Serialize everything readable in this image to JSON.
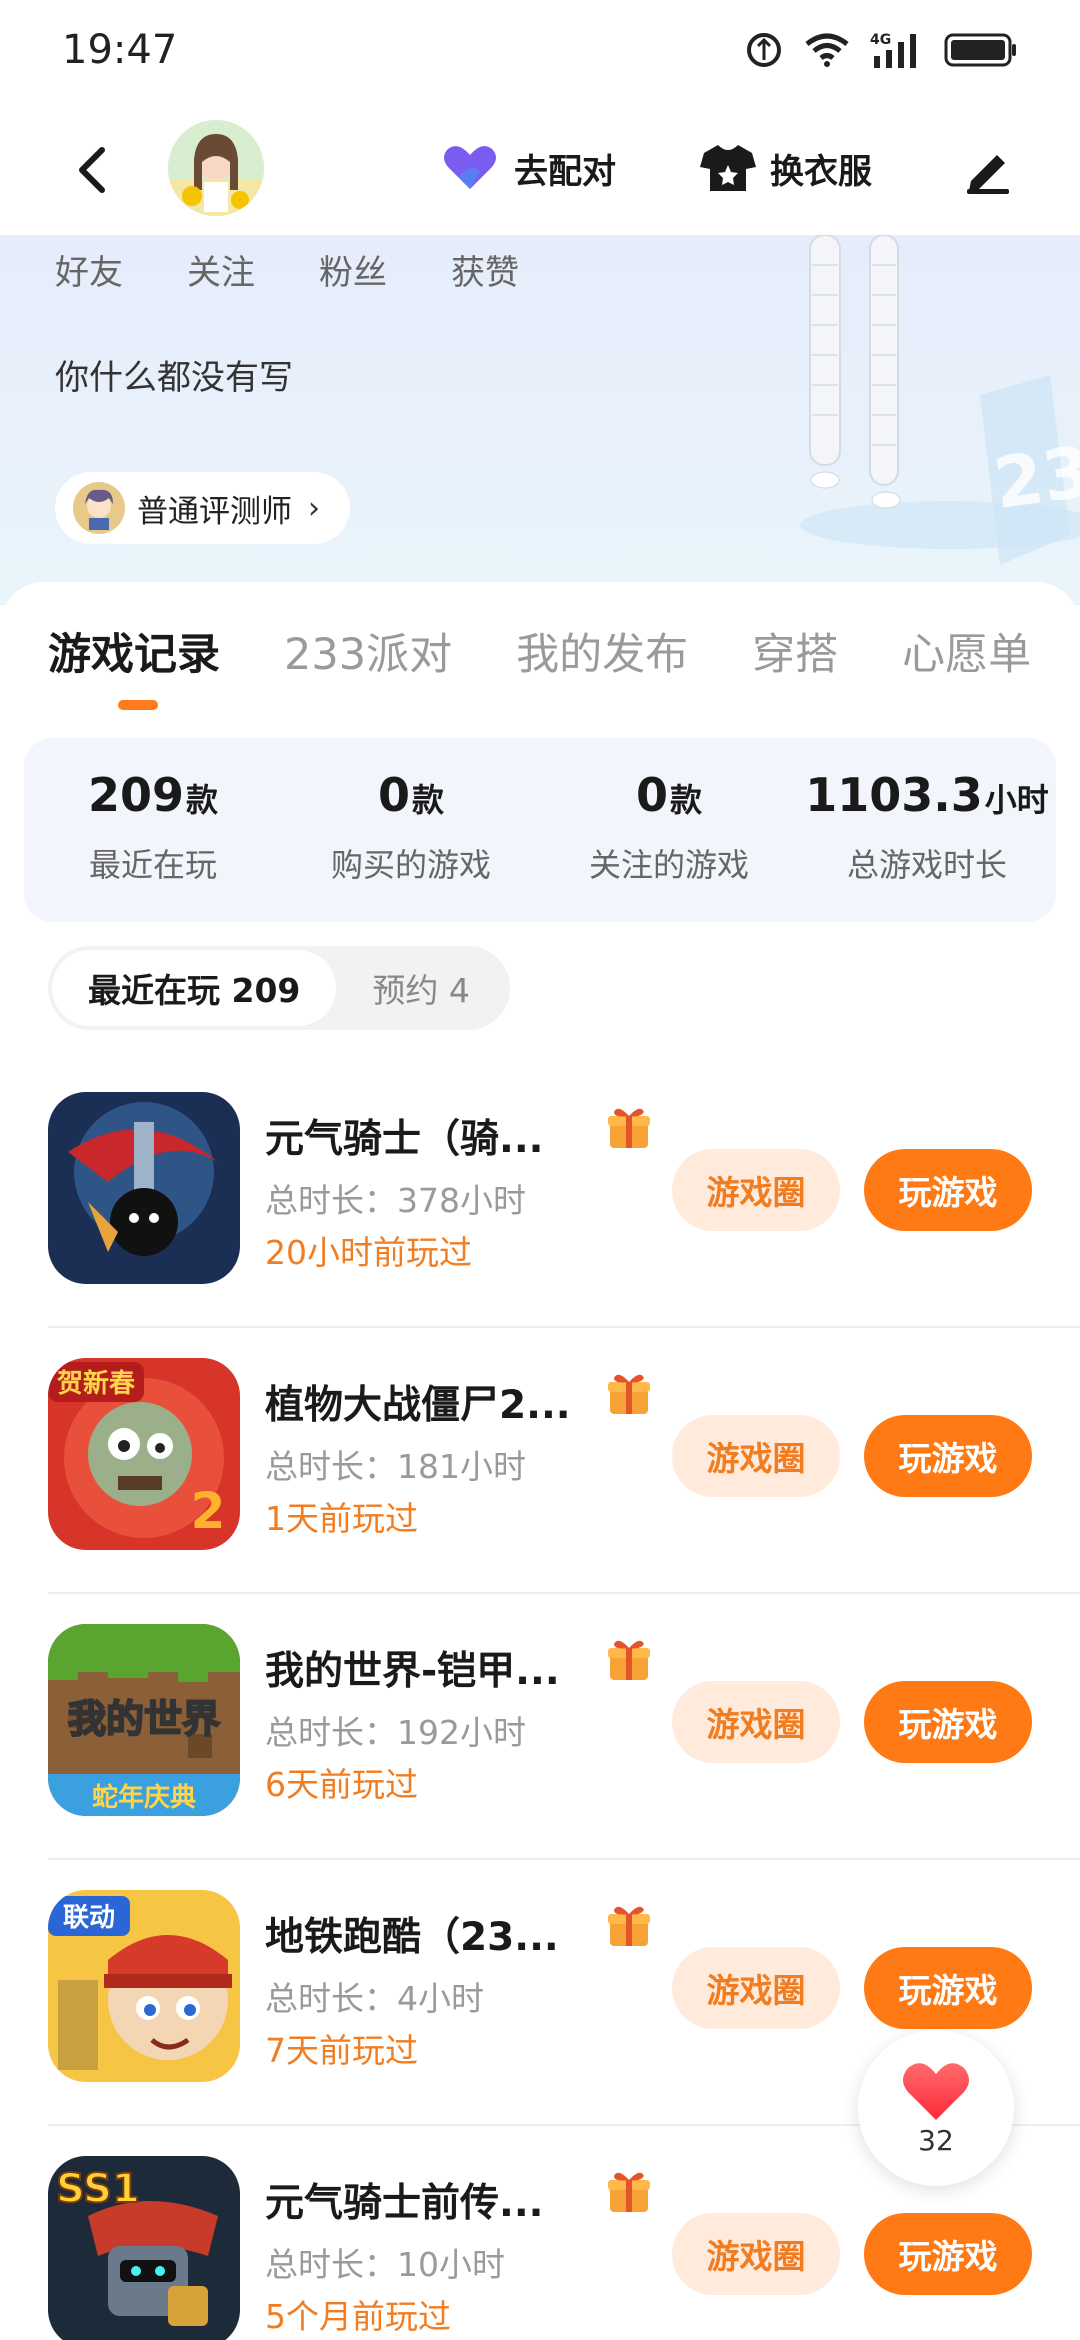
{
  "status_bar": {
    "time": "19:47",
    "network": "4G"
  },
  "nav": {
    "pair_label": "去配对",
    "dress_label": "换衣服"
  },
  "profile": {
    "stats": [
      "好友",
      "关注",
      "粉丝",
      "获赞"
    ],
    "bio": "你什么都没有写",
    "badge_label": "普通评测师",
    "badge_chevron": "›"
  },
  "tabs": [
    {
      "label": "游戏记录",
      "active": true
    },
    {
      "label": "233派对",
      "active": false
    },
    {
      "label": "我的发布",
      "active": false
    },
    {
      "label": "穿搭",
      "active": false
    },
    {
      "label": "心愿单",
      "active": false
    }
  ],
  "summary": [
    {
      "num": "209",
      "unit": "款",
      "label": "最近在玩"
    },
    {
      "num": "0",
      "unit": "款",
      "label": "购买的游戏"
    },
    {
      "num": "0",
      "unit": "款",
      "label": "关注的游戏"
    },
    {
      "num": "1103.3",
      "unit": "小时",
      "label": "总游戏时长"
    }
  ],
  "segments": [
    {
      "label": "最近在玩 209",
      "active": true
    },
    {
      "label": "预约 4",
      "active": false
    }
  ],
  "games": [
    {
      "name": "元气骑士（骑...",
      "duration": "总时长：378小时",
      "last_played": "20小时前玩过",
      "circle_label": "游戏圈",
      "play_label": "玩游戏",
      "icon": "soul-knight-icon"
    },
    {
      "name": "植物大战僵尸2...",
      "duration": "总时长：181小时",
      "last_played": "1天前玩过",
      "circle_label": "游戏圈",
      "play_label": "玩游戏",
      "icon": "pvz2-icon",
      "icon_text": "贺新春"
    },
    {
      "name": "我的世界-铠甲...",
      "duration": "总时长：192小时",
      "last_played": "6天前玩过",
      "circle_label": "游戏圈",
      "play_label": "玩游戏",
      "icon": "minecraft-icon",
      "icon_text": "我的世界",
      "icon_sub": "蛇年庆典"
    },
    {
      "name": "地铁跑酷（23...",
      "duration": "总时长：4小时",
      "last_played": "7天前玩过",
      "circle_label": "游戏圈",
      "play_label": "玩游戏",
      "icon": "subway-surfers-icon",
      "icon_text": "联动"
    },
    {
      "name": "元气骑士前传...",
      "duration": "总时长：10小时",
      "last_played": "5个月前玩过",
      "circle_label": "游戏圈",
      "play_label": "玩游戏",
      "icon": "soul-knight-prequel-icon",
      "icon_text": "SS1"
    }
  ],
  "like_fab": {
    "count": "32"
  },
  "colors": {
    "accent": "#ff7a14",
    "accent_light": "#ffeadc",
    "recent_text": "#f07d22"
  }
}
